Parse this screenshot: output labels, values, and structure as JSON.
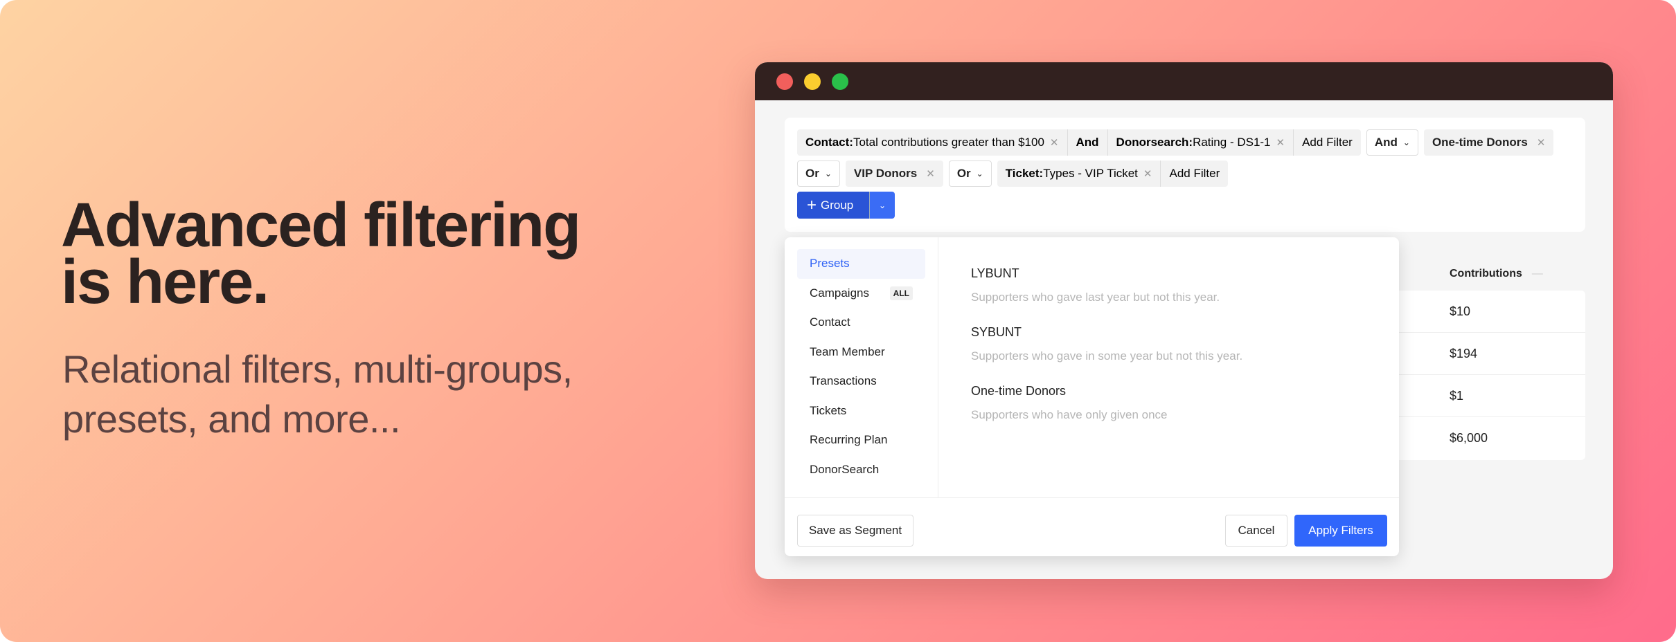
{
  "hero": {
    "line1": "Advanced filtering",
    "line2": "is here.",
    "sub1": "Relational filters, multi-groups,",
    "sub2": "presets, and more..."
  },
  "colors": {
    "accent": "#3066fb",
    "group_button": "#2a54d6",
    "titlebar": "#32211f"
  },
  "window": {
    "controls": [
      "close",
      "minimize",
      "maximize"
    ]
  },
  "filters": {
    "row1": {
      "contact_key": "Contact:",
      "contact_val": "Total contributions greater than $100",
      "and": "And",
      "donor_key": "Donorsearch:",
      "donor_val": "Rating - DS1-1",
      "add": "Add Filter",
      "op": "And",
      "preset": "One-time Donors"
    },
    "row2": {
      "op1": "Or",
      "preset": "VIP Donors",
      "op2": "Or",
      "ticket_key": "Ticket:",
      "ticket_val": "Types - VIP Ticket",
      "add": "Add Filter"
    },
    "group_label": "Group"
  },
  "table": {
    "header": "Contributions",
    "rows": [
      "$10",
      "$194",
      "$1",
      "$6,000"
    ]
  },
  "panel": {
    "nav": [
      {
        "label": "Presets"
      },
      {
        "label": "Campaigns",
        "badge": "ALL"
      },
      {
        "label": "Contact"
      },
      {
        "label": "Team Member"
      },
      {
        "label": "Transactions"
      },
      {
        "label": "Tickets"
      },
      {
        "label": "Recurring Plan"
      },
      {
        "label": "DonorSearch"
      }
    ],
    "presets": [
      {
        "title": "LYBUNT",
        "desc": "Supporters who gave last year but not this year."
      },
      {
        "title": "SYBUNT",
        "desc": "Supporters who gave in some year but not this year."
      },
      {
        "title": "One-time Donors",
        "desc": "Supporters who have only given once"
      }
    ],
    "save": "Save as Segment",
    "cancel": "Cancel",
    "apply": "Apply Filters"
  }
}
